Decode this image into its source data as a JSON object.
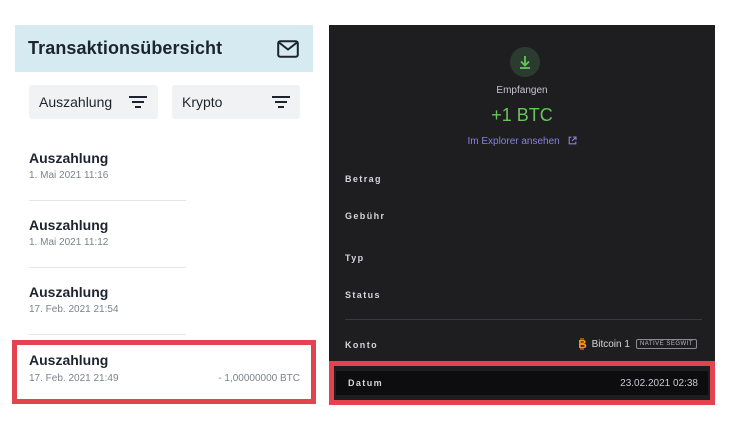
{
  "left": {
    "title": "Transaktionsübersicht",
    "filters": [
      {
        "label": "Auszahlung",
        "icon": "filter-icon"
      },
      {
        "label": "Krypto",
        "icon": "filter-icon"
      }
    ],
    "transactions": [
      {
        "title": "Auszahlung",
        "date": "1. Mai 2021 11:16"
      },
      {
        "title": "Auszahlung",
        "date": "1. Mai 2021 11:12"
      },
      {
        "title": "Auszahlung",
        "date": "17. Feb. 2021 21:54"
      },
      {
        "title": "Auszahlung",
        "date": "17. Feb. 2021 21:49",
        "amount": "- 1,00000000 BTC",
        "highlighted": true
      }
    ]
  },
  "right": {
    "status_icon": "download-icon",
    "status_label": "Empfangen",
    "amount": "+1 BTC",
    "explorer_link": "Im Explorer ansehen",
    "rows": {
      "betrag": "Betrag",
      "gebuehr": "Gebühr",
      "typ": "Typ",
      "status": "Status",
      "konto": "Konto",
      "datum": "Datum"
    },
    "account": {
      "name": "Bitcoin 1",
      "badge": "NATIVE SEGWIT",
      "icon": "bitcoin-icon"
    },
    "date_value": "23.02.2021 02:38"
  },
  "colors": {
    "highlight": "#e2434f",
    "header_bg": "#d6ebf1",
    "dark_bg": "#1e1e20",
    "received_green": "#66c55a",
    "link_purple": "#8c7ee6",
    "bitcoin_orange": "#f7931a"
  }
}
